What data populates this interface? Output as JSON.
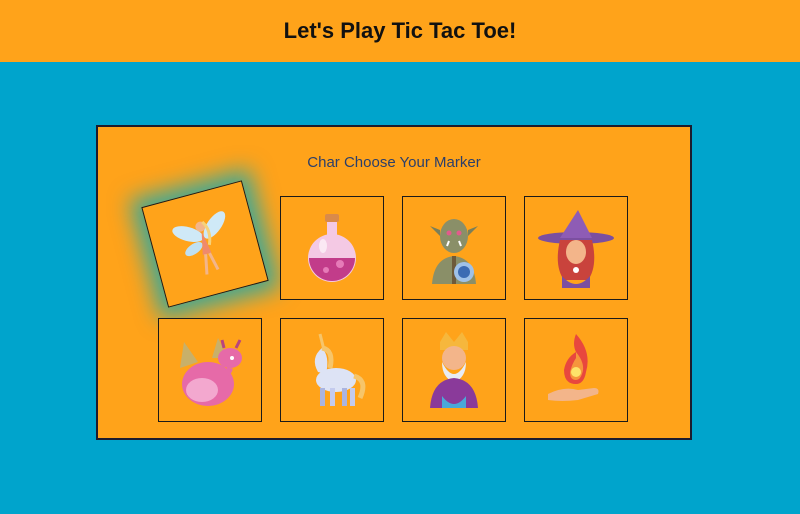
{
  "header": {
    "title": "Let's Play Tic Tac Toe!"
  },
  "panel": {
    "prompt": "Char Choose Your Marker"
  },
  "markers": [
    {
      "name": "fairy",
      "icon": "fairy-icon",
      "selected": true
    },
    {
      "name": "potion",
      "icon": "potion-icon",
      "selected": false
    },
    {
      "name": "orc",
      "icon": "orc-icon",
      "selected": false
    },
    {
      "name": "witch",
      "icon": "witch-icon",
      "selected": false
    },
    {
      "name": "dragon",
      "icon": "dragon-icon",
      "selected": false
    },
    {
      "name": "unicorn",
      "icon": "unicorn-icon",
      "selected": false
    },
    {
      "name": "king",
      "icon": "king-icon",
      "selected": false
    },
    {
      "name": "fire",
      "icon": "fire-hand-icon",
      "selected": false
    }
  ],
  "colors": {
    "background": "#00a4cc",
    "accent": "#ffa31a"
  }
}
